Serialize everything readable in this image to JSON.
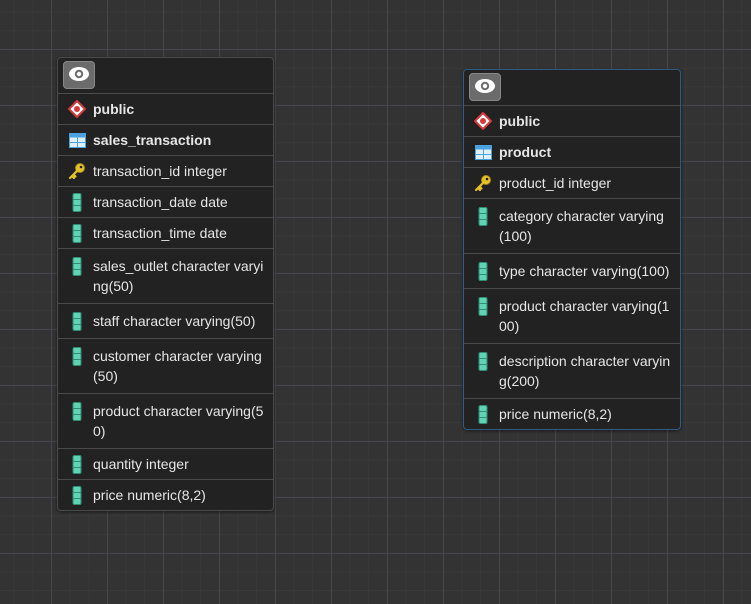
{
  "tables": [
    {
      "schema": "public",
      "name": "sales_transaction",
      "columns": [
        {
          "icon": "key-icon",
          "text": "transaction_id integer"
        },
        {
          "icon": "column-icon",
          "text": "transaction_date date"
        },
        {
          "icon": "column-icon",
          "text": "transaction_time date"
        },
        {
          "icon": "column-icon",
          "text": "sales_outlet character varying(50)"
        },
        {
          "icon": "column-icon",
          "text": "staff character varying(50)"
        },
        {
          "icon": "column-icon",
          "text": "customer character varying(50)"
        },
        {
          "icon": "column-icon",
          "text": "product character varying(50)"
        },
        {
          "icon": "column-icon",
          "text": "quantity integer"
        },
        {
          "icon": "column-icon",
          "text": "price numeric(8,2)"
        }
      ]
    },
    {
      "schema": "public",
      "name": "product",
      "columns": [
        {
          "icon": "key-icon",
          "text": "product_id integer"
        },
        {
          "icon": "column-icon",
          "text": "category character varying(100)"
        },
        {
          "icon": "column-icon",
          "text": "type character varying(100)"
        },
        {
          "icon": "column-icon",
          "text": "product character varying(100)"
        },
        {
          "icon": "column-icon",
          "text": "description character varying(200)"
        },
        {
          "icon": "column-icon",
          "text": "price numeric(8,2)"
        }
      ]
    }
  ],
  "colors": {
    "selected_border": "#2d5d86",
    "schema_icon": "#d9383a",
    "table_icon": "#4aa3df",
    "key_icon": "#e6c229",
    "column_icon": "#5fd3b3"
  }
}
